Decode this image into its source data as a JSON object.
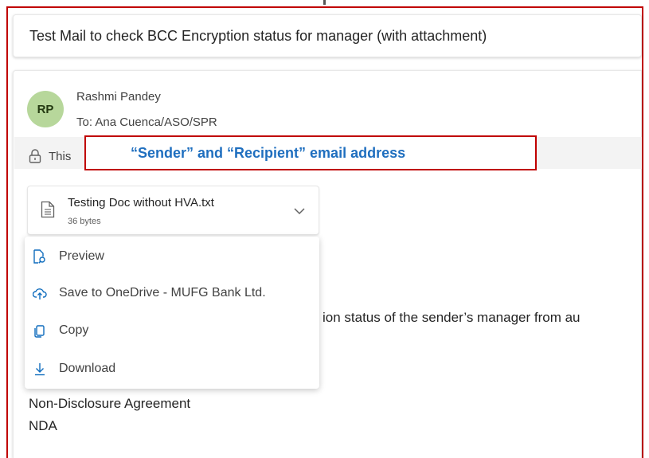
{
  "subject": "Test Mail to check BCC Encryption status for manager (with attachment)",
  "sender": {
    "initials": "RP",
    "name": "Rashmi Pandey",
    "to": "To: Ana Cuenca/ASO/SPR",
    "avatar_color": "#b7d79b"
  },
  "banner": {
    "text": "This",
    "icon": "lock-icon"
  },
  "callout": {
    "text": "“Sender” and “Recipient” email address",
    "border_color": "#c00000",
    "text_color": "#1f6fbf"
  },
  "attachment": {
    "name": "Testing Doc without HVA.txt",
    "size": "36 bytes",
    "icon": "document-icon"
  },
  "menu": {
    "items": [
      {
        "label": "Preview",
        "icon": "preview-icon"
      },
      {
        "label": "Save to OneDrive - MUFG Bank Ltd.",
        "icon": "cloud-upload-icon"
      },
      {
        "label": "Copy",
        "icon": "copy-icon"
      },
      {
        "label": "Download",
        "icon": "download-icon"
      }
    ]
  },
  "body": {
    "partial_line": "ion status of the sender’s manager from au",
    "nda_title": "Non-Disclosure Agreement",
    "nda_short": "NDA"
  },
  "accent_color": "#0f6cbd"
}
